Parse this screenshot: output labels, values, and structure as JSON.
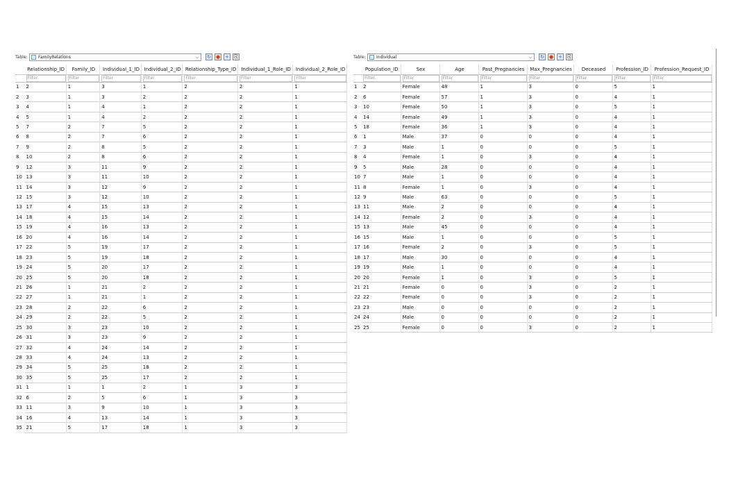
{
  "left": {
    "table_label": "Table:",
    "table_name": "FamilyRelations",
    "filter_placeholder": "Filter",
    "columns": [
      "Relationship_ID",
      "Family_ID",
      "Individual_1_ID",
      "Individual_2_ID",
      "Relationship_Type_ID",
      "Individual_1_Role_ID",
      "Individual_2_Role_ID"
    ],
    "rows": [
      [
        "1",
        "2",
        "1",
        "3",
        "1",
        "2",
        "2",
        "1"
      ],
      [
        "2",
        "3",
        "1",
        "3",
        "2",
        "2",
        "2",
        "1"
      ],
      [
        "3",
        "4",
        "1",
        "4",
        "1",
        "2",
        "2",
        "1"
      ],
      [
        "4",
        "5",
        "1",
        "4",
        "2",
        "2",
        "2",
        "1"
      ],
      [
        "5",
        "7",
        "2",
        "7",
        "5",
        "2",
        "2",
        "1"
      ],
      [
        "6",
        "8",
        "2",
        "7",
        "6",
        "2",
        "2",
        "1"
      ],
      [
        "7",
        "9",
        "2",
        "8",
        "5",
        "2",
        "2",
        "1"
      ],
      [
        "8",
        "10",
        "2",
        "8",
        "6",
        "2",
        "2",
        "1"
      ],
      [
        "9",
        "12",
        "3",
        "11",
        "9",
        "2",
        "2",
        "1"
      ],
      [
        "10",
        "13",
        "3",
        "11",
        "10",
        "2",
        "2",
        "1"
      ],
      [
        "11",
        "14",
        "3",
        "12",
        "9",
        "2",
        "2",
        "1"
      ],
      [
        "12",
        "15",
        "3",
        "12",
        "10",
        "2",
        "2",
        "1"
      ],
      [
        "13",
        "17",
        "4",
        "15",
        "13",
        "2",
        "2",
        "1"
      ],
      [
        "14",
        "18",
        "4",
        "15",
        "14",
        "2",
        "2",
        "1"
      ],
      [
        "15",
        "19",
        "4",
        "16",
        "13",
        "2",
        "2",
        "1"
      ],
      [
        "16",
        "20",
        "4",
        "16",
        "14",
        "2",
        "2",
        "1"
      ],
      [
        "17",
        "22",
        "5",
        "19",
        "17",
        "2",
        "2",
        "1"
      ],
      [
        "18",
        "23",
        "5",
        "19",
        "18",
        "2",
        "2",
        "1"
      ],
      [
        "19",
        "24",
        "5",
        "20",
        "17",
        "2",
        "2",
        "1"
      ],
      [
        "20",
        "25",
        "5",
        "20",
        "18",
        "2",
        "2",
        "1"
      ],
      [
        "21",
        "26",
        "1",
        "21",
        "2",
        "2",
        "2",
        "1"
      ],
      [
        "22",
        "27",
        "1",
        "21",
        "1",
        "2",
        "2",
        "1"
      ],
      [
        "23",
        "28",
        "2",
        "22",
        "6",
        "2",
        "2",
        "1"
      ],
      [
        "24",
        "29",
        "2",
        "22",
        "5",
        "2",
        "2",
        "1"
      ],
      [
        "25",
        "30",
        "3",
        "23",
        "10",
        "2",
        "2",
        "1"
      ],
      [
        "26",
        "31",
        "3",
        "23",
        "9",
        "2",
        "2",
        "1"
      ],
      [
        "27",
        "32",
        "4",
        "24",
        "14",
        "2",
        "2",
        "1"
      ],
      [
        "28",
        "33",
        "4",
        "24",
        "13",
        "2",
        "2",
        "1"
      ],
      [
        "29",
        "34",
        "5",
        "25",
        "18",
        "2",
        "2",
        "1"
      ],
      [
        "30",
        "35",
        "5",
        "25",
        "17",
        "2",
        "2",
        "1"
      ],
      [
        "31",
        "1",
        "1",
        "1",
        "2",
        "1",
        "3",
        "3"
      ],
      [
        "32",
        "6",
        "2",
        "5",
        "6",
        "1",
        "3",
        "3"
      ],
      [
        "33",
        "11",
        "3",
        "9",
        "10",
        "1",
        "3",
        "3"
      ],
      [
        "34",
        "16",
        "4",
        "13",
        "14",
        "1",
        "3",
        "3"
      ],
      [
        "35",
        "21",
        "5",
        "17",
        "18",
        "1",
        "3",
        "3"
      ]
    ]
  },
  "right": {
    "table_label": "Table:",
    "table_name": "Individual",
    "filter_placeholder": "Filter",
    "columns": [
      "Population_ID",
      "Sex",
      "Age",
      "Past_Pregnancies",
      "Max_Pregnancies",
      "Deceased",
      "Profession_ID",
      "Profession_Request_ID"
    ],
    "rows": [
      [
        "1",
        "2",
        "Female",
        "48",
        "1",
        "3",
        "0",
        "5",
        "1"
      ],
      [
        "2",
        "6",
        "Female",
        "57",
        "1",
        "3",
        "0",
        "4",
        "1"
      ],
      [
        "3",
        "10",
        "Female",
        "50",
        "1",
        "3",
        "0",
        "5",
        "1"
      ],
      [
        "4",
        "14",
        "Female",
        "49",
        "1",
        "3",
        "0",
        "4",
        "1"
      ],
      [
        "5",
        "18",
        "Female",
        "36",
        "1",
        "3",
        "0",
        "4",
        "1"
      ],
      [
        "6",
        "1",
        "Male",
        "37",
        "0",
        "0",
        "0",
        "4",
        "1"
      ],
      [
        "7",
        "3",
        "Male",
        "1",
        "0",
        "0",
        "0",
        "5",
        "1"
      ],
      [
        "8",
        "4",
        "Female",
        "1",
        "0",
        "3",
        "0",
        "4",
        "1"
      ],
      [
        "9",
        "5",
        "Male",
        "28",
        "0",
        "0",
        "0",
        "4",
        "1"
      ],
      [
        "10",
        "7",
        "Male",
        "1",
        "0",
        "0",
        "0",
        "4",
        "1"
      ],
      [
        "11",
        "8",
        "Female",
        "1",
        "0",
        "3",
        "0",
        "4",
        "1"
      ],
      [
        "12",
        "9",
        "Male",
        "63",
        "0",
        "0",
        "0",
        "5",
        "1"
      ],
      [
        "13",
        "11",
        "Male",
        "2",
        "0",
        "0",
        "0",
        "4",
        "1"
      ],
      [
        "14",
        "12",
        "Female",
        "2",
        "0",
        "3",
        "0",
        "4",
        "1"
      ],
      [
        "15",
        "13",
        "Male",
        "45",
        "0",
        "0",
        "0",
        "4",
        "1"
      ],
      [
        "16",
        "15",
        "Male",
        "1",
        "0",
        "0",
        "0",
        "5",
        "1"
      ],
      [
        "17",
        "16",
        "Female",
        "2",
        "0",
        "3",
        "0",
        "5",
        "1"
      ],
      [
        "18",
        "17",
        "Male",
        "30",
        "0",
        "0",
        "0",
        "4",
        "1"
      ],
      [
        "19",
        "19",
        "Male",
        "1",
        "0",
        "0",
        "0",
        "4",
        "1"
      ],
      [
        "20",
        "20",
        "Female",
        "1",
        "0",
        "3",
        "0",
        "5",
        "1"
      ],
      [
        "21",
        "21",
        "Female",
        "0",
        "0",
        "3",
        "0",
        "2",
        "1"
      ],
      [
        "22",
        "22",
        "Female",
        "0",
        "0",
        "3",
        "0",
        "2",
        "1"
      ],
      [
        "23",
        "23",
        "Male",
        "0",
        "0",
        "0",
        "0",
        "2",
        "1"
      ],
      [
        "24",
        "24",
        "Male",
        "0",
        "0",
        "0",
        "0",
        "2",
        "1"
      ],
      [
        "25",
        "25",
        "Female",
        "0",
        "0",
        "3",
        "0",
        "2",
        "1"
      ]
    ]
  },
  "icons": {
    "table_select": "table-icon",
    "dropdown": "chevron-down-icon",
    "refresh": "refresh-icon",
    "clear_filters": "clear-filters-icon",
    "add_record": "add-record-icon",
    "print": "print-icon"
  }
}
